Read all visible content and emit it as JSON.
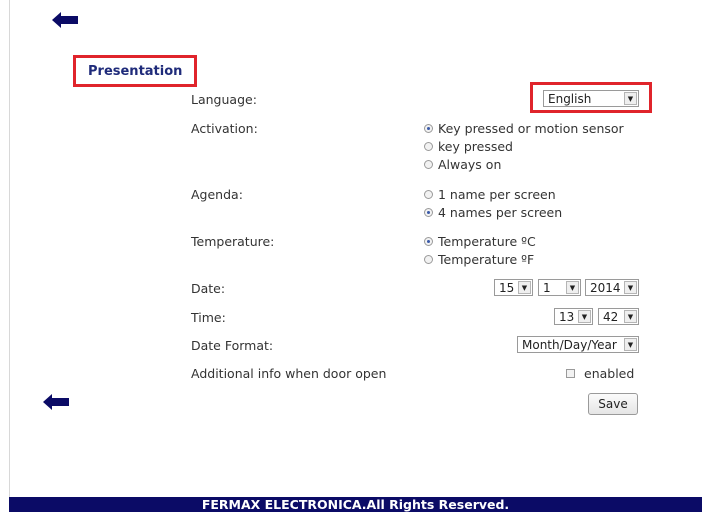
{
  "section": {
    "title": "Presentation"
  },
  "language": {
    "label": "Language:",
    "selected": "English"
  },
  "activation": {
    "label": "Activation:",
    "options": [
      {
        "label": "Key pressed or motion sensor",
        "checked": true
      },
      {
        "label": "key pressed",
        "checked": false
      },
      {
        "label": "Always on",
        "checked": false
      }
    ]
  },
  "agenda": {
    "label": "Agenda:",
    "options": [
      {
        "label": "1 name per screen",
        "checked": false
      },
      {
        "label": "4 names per screen",
        "checked": true
      }
    ]
  },
  "temperature": {
    "label": "Temperature:",
    "options": [
      {
        "label": "Temperature ºC",
        "checked": true
      },
      {
        "label": "Temperature ºF",
        "checked": false
      }
    ]
  },
  "date": {
    "label": "Date:",
    "day": "15",
    "month": "1",
    "year": "2014"
  },
  "time": {
    "label": "Time:",
    "hour": "13",
    "minute": "42"
  },
  "date_format": {
    "label": "Date Format:",
    "selected": "Month/Day/Year"
  },
  "door_info": {
    "label": "Additional info when door open",
    "checkbox_label": "enabled",
    "checked": false
  },
  "buttons": {
    "save": "Save"
  },
  "footer": {
    "text": "FERMAX ELECTRONICA.All Rights Reserved."
  },
  "icons": {
    "back": "arrow-left-icon"
  },
  "colors": {
    "brand_navy": "#0b0b66",
    "highlight_red": "#e0242b",
    "title_navy": "#1f2b7a"
  }
}
